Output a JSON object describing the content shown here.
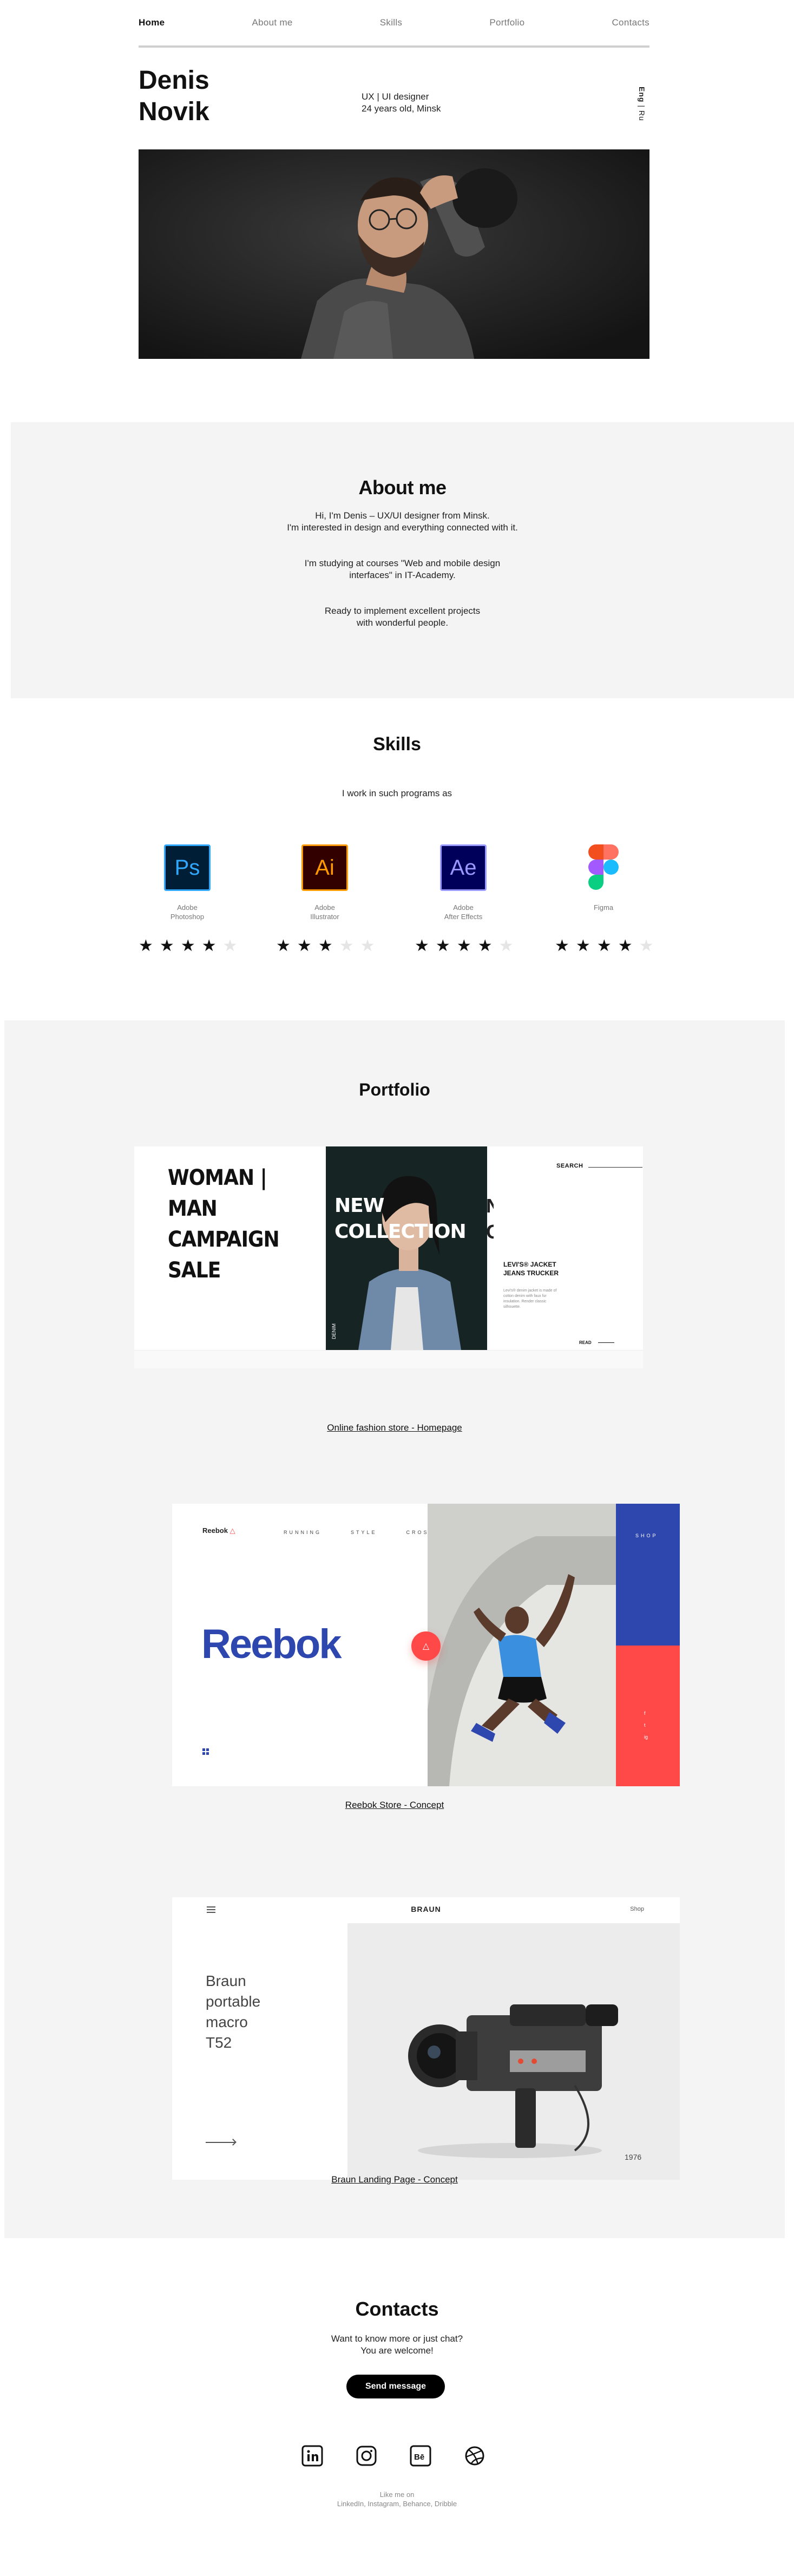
{
  "nav": {
    "items": [
      {
        "label": "Home",
        "active": true
      },
      {
        "label": "About me",
        "active": false
      },
      {
        "label": "Skills",
        "active": false
      },
      {
        "label": "Portfolio",
        "active": false
      },
      {
        "label": "Contacts",
        "active": false
      }
    ]
  },
  "hero": {
    "first_name": "Denis",
    "last_name": "Novik",
    "role": "UX | UI designer",
    "details": "24 years old, Minsk",
    "lang_active": "Eng",
    "lang_separator": " | ",
    "lang_other": "Ru"
  },
  "about": {
    "title": "About me",
    "p1_line1": "Hi, I'm Denis – UX/UI designer from Minsk.",
    "p1_line2": "I'm interested in design and everything connected with it.",
    "p2": "I'm studying at courses \"Web and mobile design interfaces\" in IT-Academy.",
    "p3": "Ready to implement excellent projects with wonderful people."
  },
  "skills": {
    "title": "Skills",
    "subtitle": "I work in such programs as",
    "items": [
      {
        "abbr": "Ps",
        "line1": "Adobe",
        "line2": "Photoshop",
        "rating": 4,
        "max": 5,
        "icon": "photoshop-icon",
        "color": "#31a8ff",
        "bg": "#001e36"
      },
      {
        "abbr": "Ai",
        "line1": "Adobe",
        "line2": "Illustrator",
        "rating": 3,
        "max": 5,
        "icon": "illustrator-icon",
        "color": "#ff9a00",
        "bg": "#330000"
      },
      {
        "abbr": "Ae",
        "line1": "Adobe",
        "line2": "After Effects",
        "rating": 4,
        "max": 5,
        "icon": "after-effects-icon",
        "color": "#9999ff",
        "bg": "#00005b"
      },
      {
        "abbr": "",
        "line1": "Figma",
        "line2": "",
        "rating": 4,
        "max": 5,
        "icon": "figma-icon",
        "color": "#f24e1e",
        "bg": "#ffffff"
      }
    ]
  },
  "portfolio": {
    "title": "Portfolio",
    "projects": [
      {
        "caption": "Online fashion store - Homepage",
        "headline_lines": [
          "WOMAN |",
          "MAN",
          "CAMPAIGN",
          "SALE"
        ],
        "banner": "NEW COLLECTION",
        "search": "SEARCH",
        "product_title": "LEVI'S® JACKET JEANS TRUCKER",
        "product_desc": "Levi's® denim jacket is made of cotton denim with faux fur insulation. Render classic silhouette.",
        "product_link": "READ",
        "side_label": "DENIM"
      },
      {
        "caption": "Reebok Store - Concept",
        "brand_small": "Reebok",
        "nav": [
          "RUNNING",
          "STYLE",
          "CROSSFIT"
        ],
        "brand_big": "Reebok",
        "shop": "SHOP",
        "social": [
          "f",
          "t",
          "ig"
        ]
      },
      {
        "caption": "Braun Landing Page - Concept",
        "brand": "BRAUN",
        "shop": "Shop",
        "title_lines": [
          "Braun",
          "portable",
          "macro",
          "T52"
        ],
        "year": "1976"
      }
    ]
  },
  "contacts": {
    "title": "Contacts",
    "line1": "Want to know more or just chat?",
    "line2": "You are welcome!",
    "button": "Send message",
    "follow_line1": "Like me on",
    "follow_line2": "LinkedIn, Instagram, Behance, Dribble"
  },
  "colors": {
    "background": "#ffffff",
    "section_bg": "#f4f4f4",
    "reebok_blue": "#2d47ae",
    "reebok_red": "#ff4848"
  }
}
